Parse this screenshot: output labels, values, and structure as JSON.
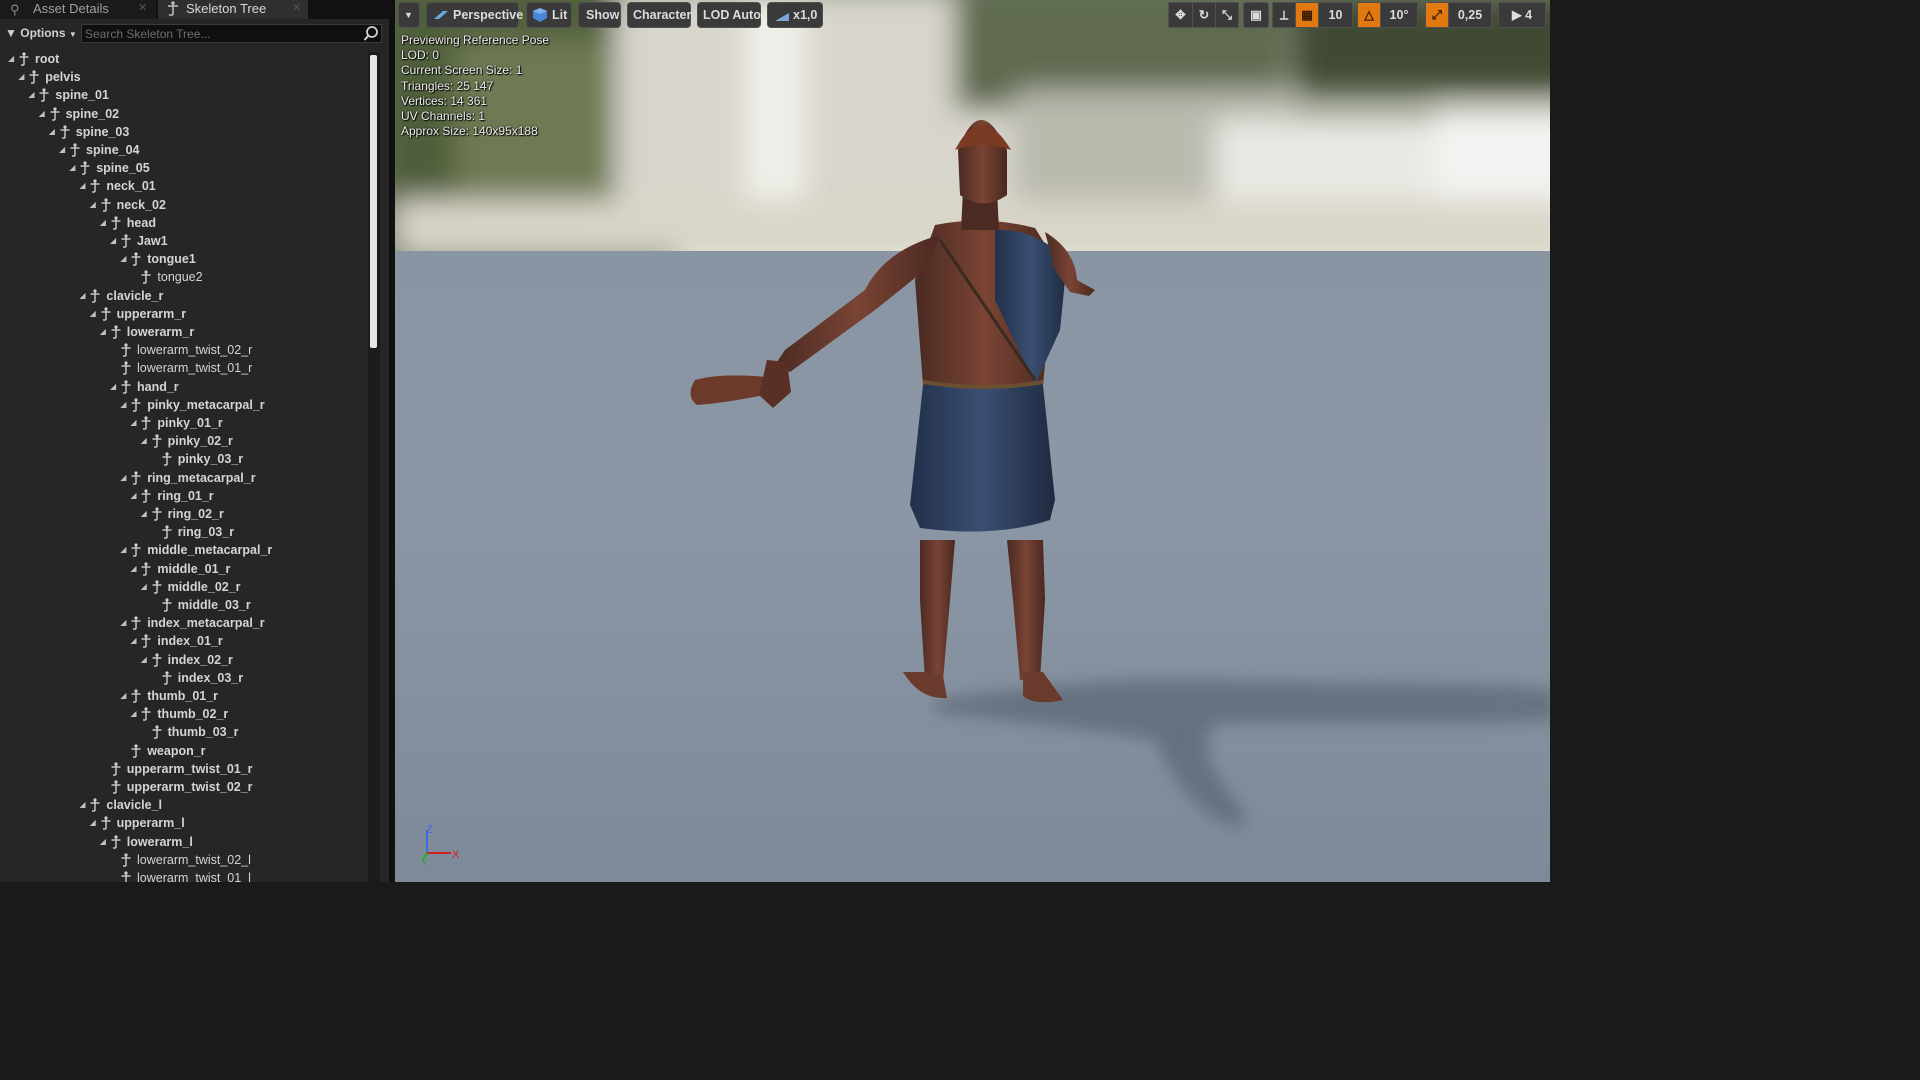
{
  "tabs": [
    {
      "label": "Asset Details",
      "icon": "asset-details-icon",
      "active": false
    },
    {
      "label": "Skeleton Tree",
      "icon": "skeleton-icon",
      "active": true
    }
  ],
  "skeleton_panel": {
    "options_label": "Options",
    "search_placeholder": "Search Skeleton Tree...",
    "bones": [
      {
        "name": "root",
        "depth": 0
      },
      {
        "name": "pelvis",
        "depth": 1
      },
      {
        "name": "spine_01",
        "depth": 2
      },
      {
        "name": "spine_02",
        "depth": 3
      },
      {
        "name": "spine_03",
        "depth": 4
      },
      {
        "name": "spine_04",
        "depth": 5
      },
      {
        "name": "spine_05",
        "depth": 6
      },
      {
        "name": "neck_01",
        "depth": 7
      },
      {
        "name": "neck_02",
        "depth": 8
      },
      {
        "name": "head",
        "depth": 9
      },
      {
        "name": "Jaw1",
        "depth": 10
      },
      {
        "name": "tongue1",
        "depth": 11
      },
      {
        "name": "tongue2",
        "depth": 12
      },
      {
        "name": "clavicle_r",
        "depth": 7
      },
      {
        "name": "upperarm_r",
        "depth": 8
      },
      {
        "name": "lowerarm_r",
        "depth": 9
      },
      {
        "name": "lowerarm_twist_02_r",
        "depth": 10
      },
      {
        "name": "lowerarm_twist_01_r",
        "depth": 10
      },
      {
        "name": "hand_r",
        "depth": 10
      },
      {
        "name": "pinky_metacarpal_r",
        "depth": 11
      },
      {
        "name": "pinky_01_r",
        "depth": 12
      },
      {
        "name": "pinky_02_r",
        "depth": 13
      },
      {
        "name": "pinky_03_r",
        "depth": 14
      },
      {
        "name": "ring_metacarpal_r",
        "depth": 11
      },
      {
        "name": "ring_01_r",
        "depth": 12
      },
      {
        "name": "ring_02_r",
        "depth": 13
      },
      {
        "name": "ring_03_r",
        "depth": 14
      },
      {
        "name": "middle_metacarpal_r",
        "depth": 11
      },
      {
        "name": "middle_01_r",
        "depth": 12
      },
      {
        "name": "middle_02_r",
        "depth": 13
      },
      {
        "name": "middle_03_r",
        "depth": 14
      },
      {
        "name": "index_metacarpal_r",
        "depth": 11
      },
      {
        "name": "index_01_r",
        "depth": 12
      },
      {
        "name": "index_02_r",
        "depth": 13
      },
      {
        "name": "index_03_r",
        "depth": 14
      },
      {
        "name": "thumb_01_r",
        "depth": 11
      },
      {
        "name": "thumb_02_r",
        "depth": 12
      },
      {
        "name": "thumb_03_r",
        "depth": 13
      },
      {
        "name": "weapon_r",
        "depth": 11
      },
      {
        "name": "upperarm_twist_01_r",
        "depth": 9
      },
      {
        "name": "upperarm_twist_02_r",
        "depth": 9
      },
      {
        "name": "clavicle_l",
        "depth": 7
      },
      {
        "name": "upperarm_l",
        "depth": 8
      },
      {
        "name": "lowerarm_l",
        "depth": 9
      },
      {
        "name": "lowerarm_twist_02_l",
        "depth": 10
      },
      {
        "name": "lowerarm_twist_01_l",
        "depth": 10
      }
    ]
  },
  "viewport_toolbar": {
    "menu_icon": "chevron-down-icon",
    "perspective_label": "Perspective",
    "lit_label": "Lit",
    "show_label": "Show",
    "character_label": "Character",
    "lod_label": "LOD Auto",
    "speed_label": "x1,0",
    "grid_snap_value": "10",
    "rotation_snap_value": "10°",
    "scale_snap_value": "0,25",
    "camera_speed_value": "4"
  },
  "info_overlay": [
    "Previewing Reference Pose",
    "LOD: 0",
    "Current Screen Size: 1",
    "Triangles: 25 147",
    "Vertices: 14 361",
    "UV Channels: 1",
    "Approx Size: 140x95x188"
  ],
  "axis_labels": {
    "z": "Z",
    "x": "X",
    "y": "Y"
  },
  "colors": {
    "accent_orange": "#e07a10",
    "panel_bg": "#262626",
    "axis_x": "#d02020",
    "axis_y": "#20b020",
    "axis_z": "#3060e0"
  }
}
